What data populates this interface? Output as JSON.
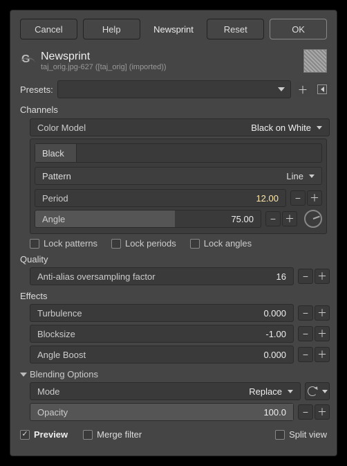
{
  "buttons": {
    "cancel": "Cancel",
    "help": "Help",
    "name": "Newsprint",
    "reset": "Reset",
    "ok": "OK"
  },
  "header": {
    "title": "Newsprint",
    "subtitle": "taj_orig.jpg-627 ([taj_orig] (imported))"
  },
  "presets": {
    "label": "Presets:"
  },
  "channels": {
    "label": "Channels",
    "colorModel": {
      "label": "Color Model",
      "value": "Black on White"
    },
    "tab": "Black",
    "pattern": {
      "label": "Pattern",
      "value": "Line"
    },
    "period": {
      "label": "Period",
      "value": "12.00"
    },
    "angle": {
      "label": "Angle",
      "value": "75.00"
    },
    "locks": {
      "patterns": "Lock patterns",
      "periods": "Lock periods",
      "angles": "Lock angles"
    }
  },
  "quality": {
    "label": "Quality",
    "aa": {
      "label": "Anti-alias oversampling factor",
      "value": "16"
    }
  },
  "effects": {
    "label": "Effects",
    "turbulence": {
      "label": "Turbulence",
      "value": "0.000"
    },
    "blocksize": {
      "label": "Blocksize",
      "value": "-1.00"
    },
    "angleboost": {
      "label": "Angle Boost",
      "value": "0.000"
    }
  },
  "blending": {
    "label": "Blending Options",
    "mode": {
      "label": "Mode",
      "value": "Replace"
    },
    "opacity": {
      "label": "Opacity",
      "value": "100.0"
    }
  },
  "footer": {
    "preview": "Preview",
    "merge": "Merge filter",
    "split": "Split view"
  }
}
